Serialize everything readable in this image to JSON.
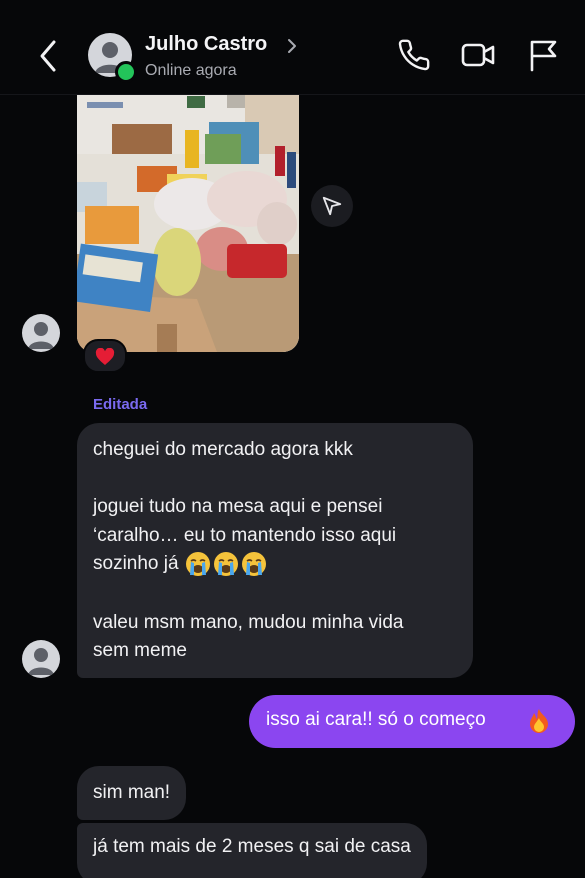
{
  "header": {
    "contact_name": "Julho Castro",
    "status": "Online agora"
  },
  "conversation": {
    "edited_label": "Editada",
    "reaction": "❤️",
    "message1": {
      "line1": "cheguei do mercado agora kkk",
      "line2": "joguei tudo na mesa aqui e pensei",
      "line3": "‘caralho… eu to mantendo isso aqui",
      "line4": "sozinho já",
      "line5": "valeu msm mano, mudou minha vida",
      "line6": "sem meme"
    },
    "message2": "isso ai cara!! só o começo",
    "message3": "sim man!",
    "message4": "já tem mais de 2 meses q sai de casa"
  },
  "colors": {
    "background": "#060709",
    "incoming_bubble": "#24252b",
    "outgoing_bubble": "#8b46f0",
    "edited_label": "#7a6af0",
    "online": "#23c45a"
  },
  "icons": [
    "back-arrow-icon",
    "chevron-right-icon",
    "phone-icon",
    "video-camera-icon",
    "flag-icon",
    "send-share-icon",
    "heart-reaction-icon",
    "crying-face-emoji",
    "fire-emoji"
  ]
}
